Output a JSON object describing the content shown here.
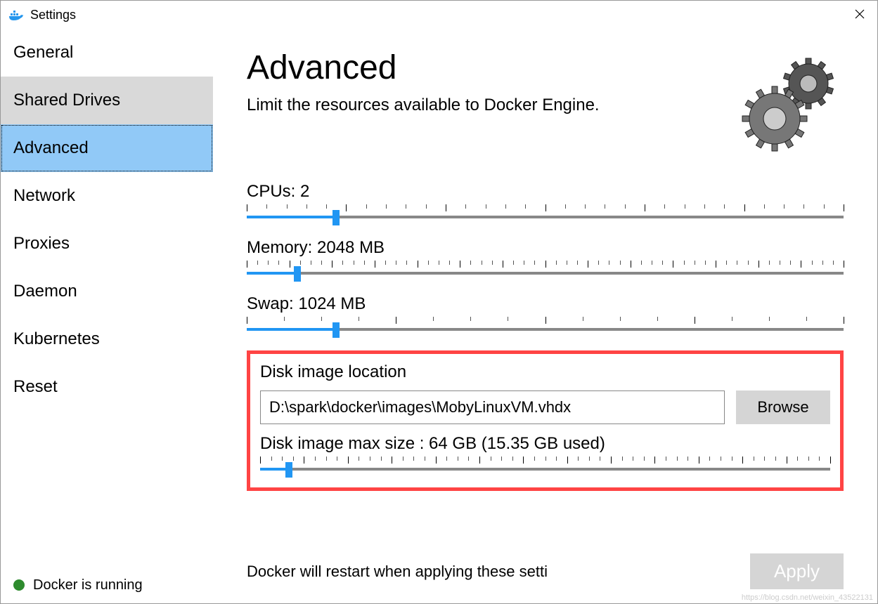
{
  "window": {
    "title": "Settings"
  },
  "sidebar": {
    "items": [
      "General",
      "Shared Drives",
      "Advanced",
      "Network",
      "Proxies",
      "Daemon",
      "Kubernetes",
      "Reset"
    ],
    "selected_index": 2
  },
  "status": {
    "text": "Docker is running",
    "color": "#2e8b2e"
  },
  "page": {
    "title": "Advanced",
    "subtitle": "Limit the resources available to Docker Engine."
  },
  "sliders": {
    "cpus": {
      "label": "CPUs: 2",
      "fill_pct": 15,
      "ticks_major": 7,
      "ticks_minor_per": 5
    },
    "memory": {
      "label": "Memory: 2048 MB",
      "fill_pct": 8.5,
      "ticks_major": 15,
      "ticks_minor_per": 4
    },
    "swap": {
      "label": "Swap: 1024 MB",
      "fill_pct": 15,
      "ticks_major": 5,
      "ticks_minor_per": 4
    },
    "disk": {
      "label": "Disk image max size : 64 GB (15.35 GB  used)",
      "fill_pct": 5,
      "ticks_major": 14,
      "ticks_minor_per": 4
    }
  },
  "disk": {
    "section_label": "Disk image location",
    "path": "D:\\spark\\docker\\images\\MobyLinuxVM.vhdx",
    "browse_label": "Browse"
  },
  "footer": {
    "text": "Docker will restart when applying these setti",
    "apply_label": "Apply"
  },
  "watermark": "https://blog.csdn.net/weixin_43522131"
}
